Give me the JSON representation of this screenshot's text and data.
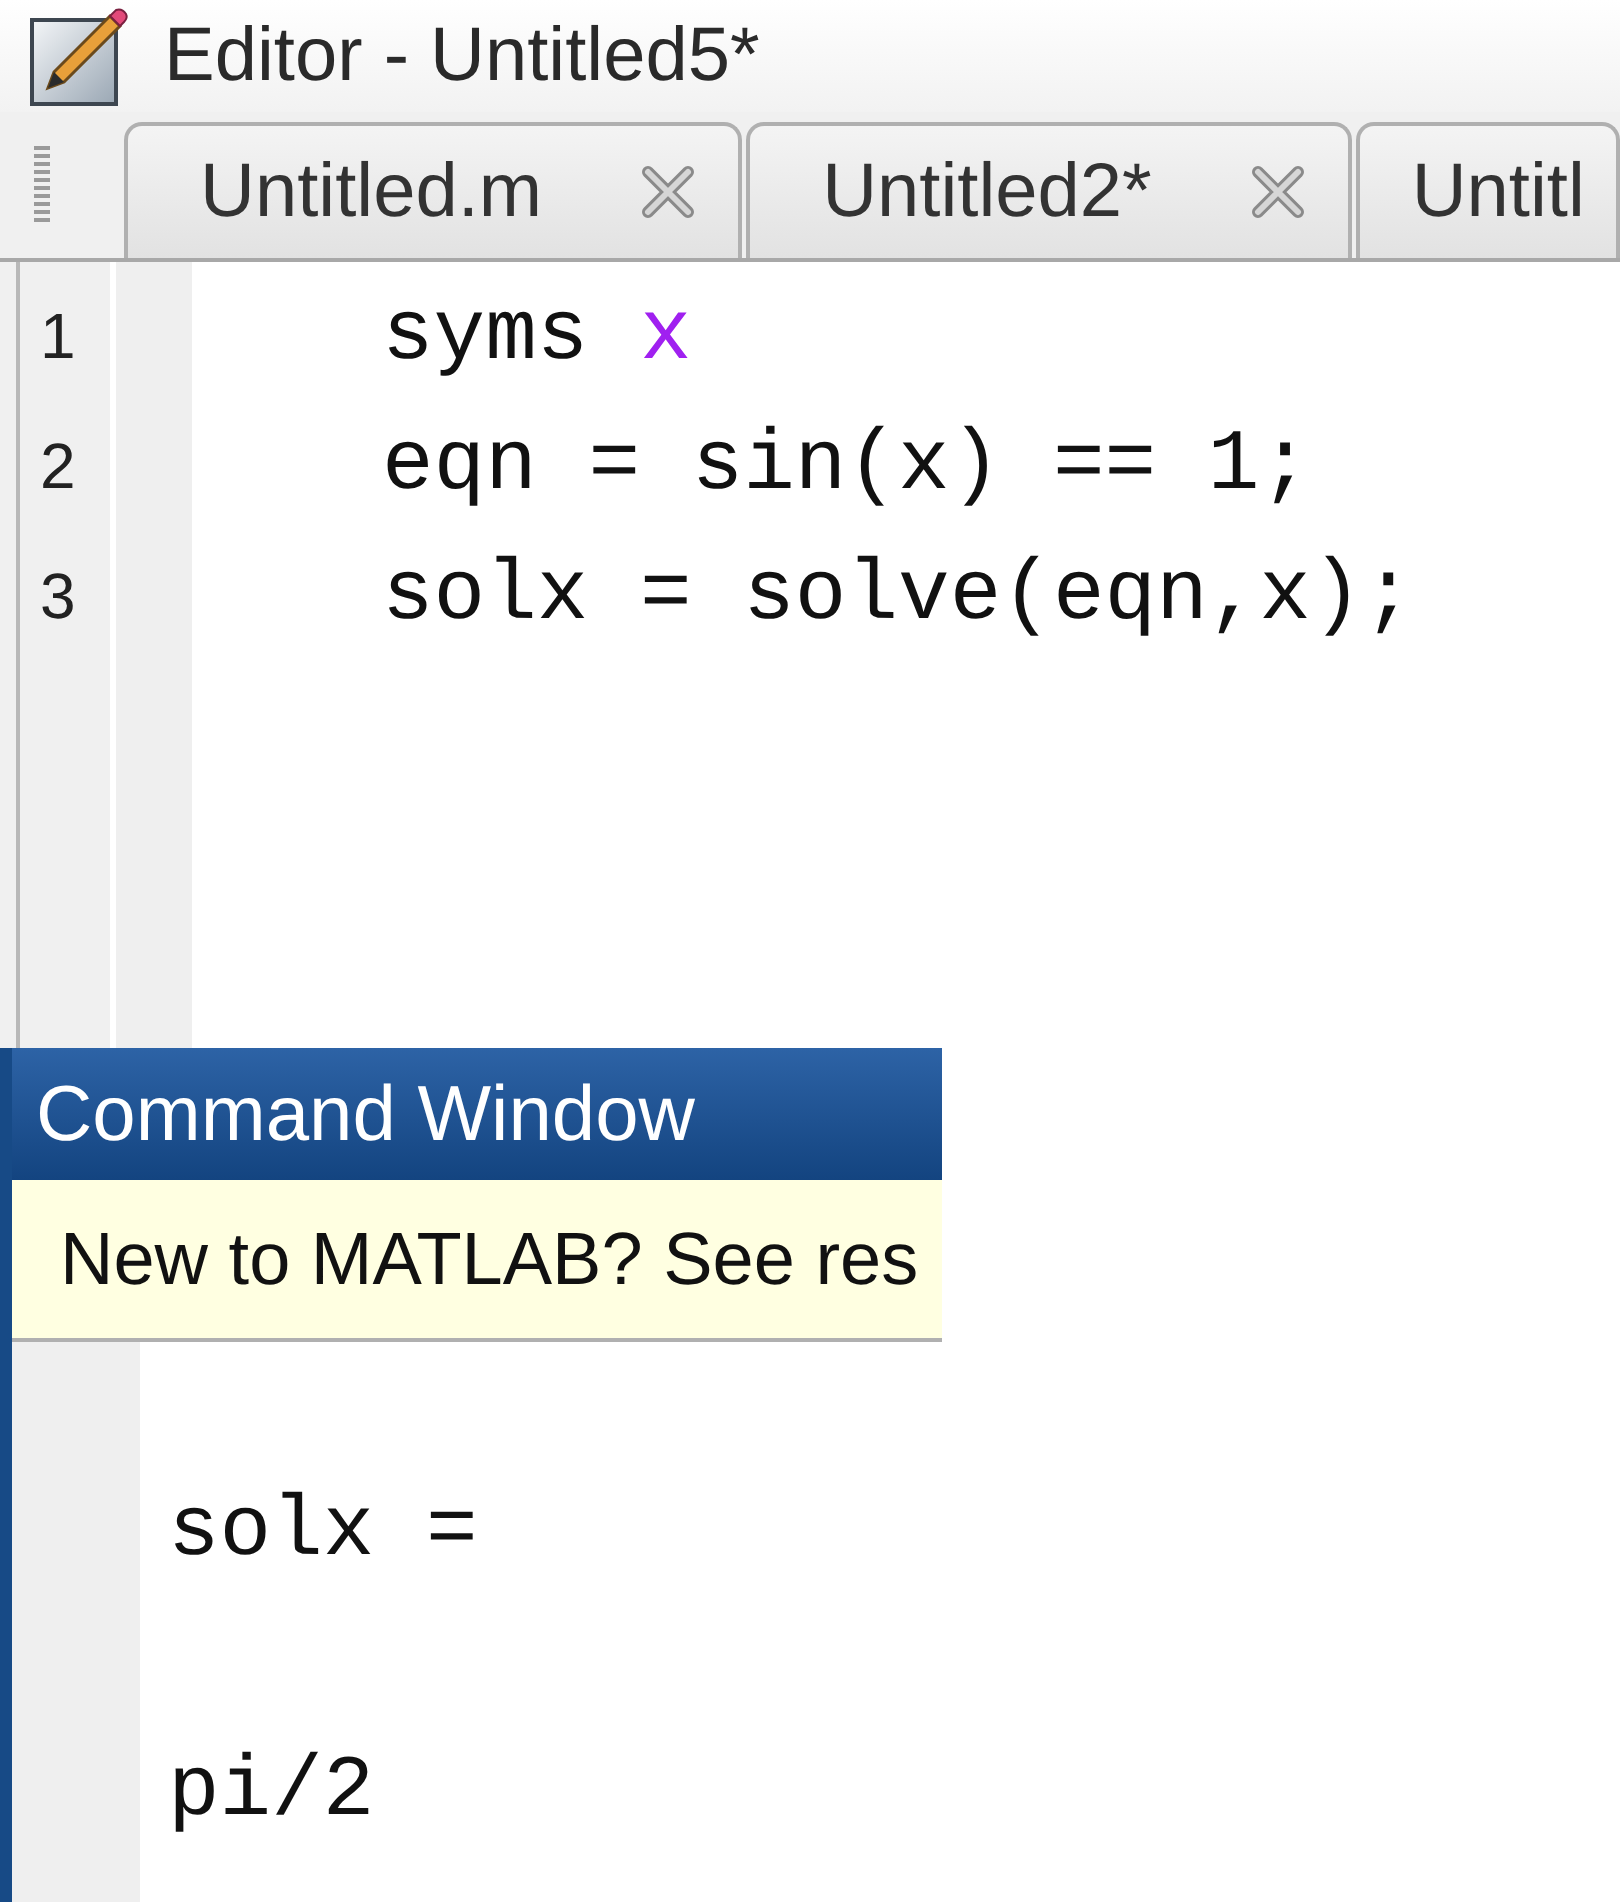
{
  "editor": {
    "title": "Editor - Untitled5*",
    "tabs": [
      {
        "label": "Untitled.m",
        "selected": false,
        "closable": true
      },
      {
        "label": "Untitled2*",
        "selected": false,
        "closable": true
      },
      {
        "label": "Untitl",
        "selected": false,
        "closable": false
      }
    ],
    "lines": [
      {
        "number": "1",
        "tokens": [
          {
            "text": "syms ",
            "kind": "plain"
          },
          {
            "text": "x",
            "kind": "symbol"
          }
        ]
      },
      {
        "number": "2",
        "tokens": [
          {
            "text": "eqn = sin(x) == 1;",
            "kind": "plain"
          }
        ]
      },
      {
        "number": "3",
        "tokens": [
          {
            "text": "solx = solve(eqn,x);",
            "kind": "plain"
          }
        ]
      }
    ]
  },
  "command_window": {
    "title": "Command Window",
    "notice": "New to MATLAB? See res",
    "output": [
      "solx =",
      "pi/2"
    ]
  }
}
